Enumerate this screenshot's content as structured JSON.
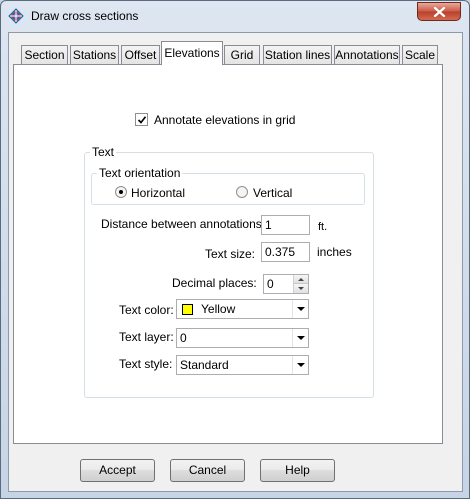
{
  "window": {
    "title": "Draw cross sections",
    "icon": "crosshair-app-icon"
  },
  "tabs": [
    {
      "label": "Section",
      "active": false
    },
    {
      "label": "Stations",
      "active": false
    },
    {
      "label": "Offset",
      "active": false
    },
    {
      "label": "Elevations",
      "active": true
    },
    {
      "label": "Grid",
      "active": false
    },
    {
      "label": "Station lines",
      "active": false
    },
    {
      "label": "Annotations",
      "active": false
    },
    {
      "label": "Scale",
      "active": false
    }
  ],
  "annotate_checkbox": {
    "label": "Annotate elevations in grid",
    "checked": true
  },
  "text_group": {
    "legend": "Text",
    "orientation": {
      "legend": "Text orientation",
      "options": [
        "Horizontal",
        "Vertical"
      ],
      "selected": "Horizontal"
    },
    "distance": {
      "label": "Distance between annotations:",
      "value": "1",
      "unit": "ft."
    },
    "text_size": {
      "label": "Text size:",
      "value": "0.375",
      "unit": "inches"
    },
    "decimal_places": {
      "label": "Decimal places:",
      "value": "0"
    },
    "text_color": {
      "label": "Text color:",
      "value": "Yellow",
      "swatch": "#ffff00"
    },
    "text_layer": {
      "label": "Text layer:",
      "value": "0"
    },
    "text_style": {
      "label": "Text style:",
      "value": "Standard"
    }
  },
  "buttons": {
    "accept": "Accept",
    "cancel": "Cancel",
    "help": "Help"
  }
}
